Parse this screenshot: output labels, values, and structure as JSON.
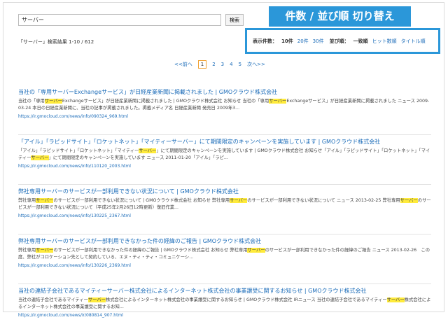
{
  "search": {
    "value": "サーバー",
    "button_label": "検索"
  },
  "result_count": "「サーバー」検索結果 1-10 / 612",
  "callout": "件数 / 並び順 切り替え",
  "display": {
    "count_label": "表示件数：",
    "count_current": "10件",
    "count_links": [
      "20件",
      "30件"
    ],
    "order_label": "並び順：",
    "order_current": "一致順",
    "order_links": [
      "ヒット数順",
      "タイトル順"
    ]
  },
  "pagination": {
    "prev": "<<前へ",
    "pages": [
      "1",
      "2",
      "3",
      "4",
      "5"
    ],
    "current": "1",
    "next": "次へ>>"
  },
  "results": [
    {
      "title": "当社の「専用サーバーExchangeサービス」が日経産業新聞に掲載されました | GMOクラウド株式会社",
      "snippet": [
        {
          "t": "当社の「専用"
        },
        {
          "t": "サーバー",
          "h": true
        },
        {
          "t": "Exchangeサービス」が日経産業新聞に掲載されました | GMOクラウド株式会社 お知らせ 当社の「専用"
        },
        {
          "t": "サーバー",
          "h": true
        },
        {
          "t": "Exchangeサービス」が日経産業新聞に掲載されました ニュース 2009-03-24 本日の日経産業新聞に、当社の記事が掲載されました。掲載メディア名 日経産業新聞 発売日 2009年3..."
        }
      ],
      "url": "https://ir.gmocloud.com/news/info/090324_969.html"
    },
    {
      "title": "「アイル」「ラピッドサイト」「ロケットネット」「マイティーサーバー」にて期間限定のキャンペーンを実施しています | GMOクラウド株式会社",
      "snippet": [
        {
          "t": "「アイル」「ラピッドサイト」「ロケットネット」「マイティー"
        },
        {
          "t": "サーバー",
          "h": true
        },
        {
          "t": "」にて期間限定のキャンペーンを実施しています | GMOクラウド株式会社 お知らせ「アイル」「ラピッドサイト」「ロケットネット」「マイティー"
        },
        {
          "t": "サーバー",
          "h": true
        },
        {
          "t": "」にて期間限定のキャンペーンを実施しています ニュース 2011-01-20「アイル」「ラピ..."
        }
      ],
      "url": "https://ir.gmocloud.com/news/info/110120_2003.html"
    },
    {
      "title": "弊社専用サーバーのサービスが一部利用できない状況について | GMOクラウド株式会社",
      "snippet": [
        {
          "t": "弊社専用"
        },
        {
          "t": "サーバー",
          "h": true
        },
        {
          "t": "のサービスが一部利用できない状況について | GMOクラウド株式会社 お知らせ 弊社専用"
        },
        {
          "t": "サーバー",
          "h": true
        },
        {
          "t": "のサービスが一部利用できない状況について ニュース 2013-02-25 弊社専用"
        },
        {
          "t": "サーバー",
          "h": true
        },
        {
          "t": "のサービスが一部利用できない状況について（平成25年2月26日12時更新）復旧作業..."
        }
      ],
      "url": "https://ir.gmocloud.com/news/info/130225_2367.html"
    },
    {
      "title": "弊社専用サーバーのサービスが一部利用できなかった件の経緯のご報告 | GMOクラウド株式会社",
      "snippet": [
        {
          "t": "弊社専用"
        },
        {
          "t": "サーバー",
          "h": true
        },
        {
          "t": "のサービスが一部利用できなかった件の経緯のご報告 | GMOクラウド株式会社 お知らせ 弊社専用"
        },
        {
          "t": "サーバー",
          "h": true
        },
        {
          "t": "のサービスが一部利用できなかった件の経緯のご報告 ニュース 2013-02-26　この度、弊社がコロケーション先として契約している、エヌ・ティ・ティ・コミュニケーシ..."
        }
      ],
      "url": "https://ir.gmocloud.com/news/info/130226_2369.html"
    },
    {
      "title": "当社の連結子会社であるマイティーサーバー株式会社によるインターネット株式会社の事業譲受に関するお知らせ | GMOクラウド株式会社",
      "snippet": [
        {
          "t": "当社の連結子会社であるマイティー"
        },
        {
          "t": "サーバー",
          "h": true
        },
        {
          "t": "株式会社によるインターネット株式会社の事業譲受に関するお知らせ | GMOクラウド株式会社 IRニュース 当社の連結子会社であるマイティー"
        },
        {
          "t": "サーバー",
          "h": true
        },
        {
          "t": "株式会社によるインターネット株式会社の事業譲受に関するお知..."
        }
      ],
      "url": "https://ir.gmocloud.com/news/ir/080814_907.html"
    }
  ]
}
